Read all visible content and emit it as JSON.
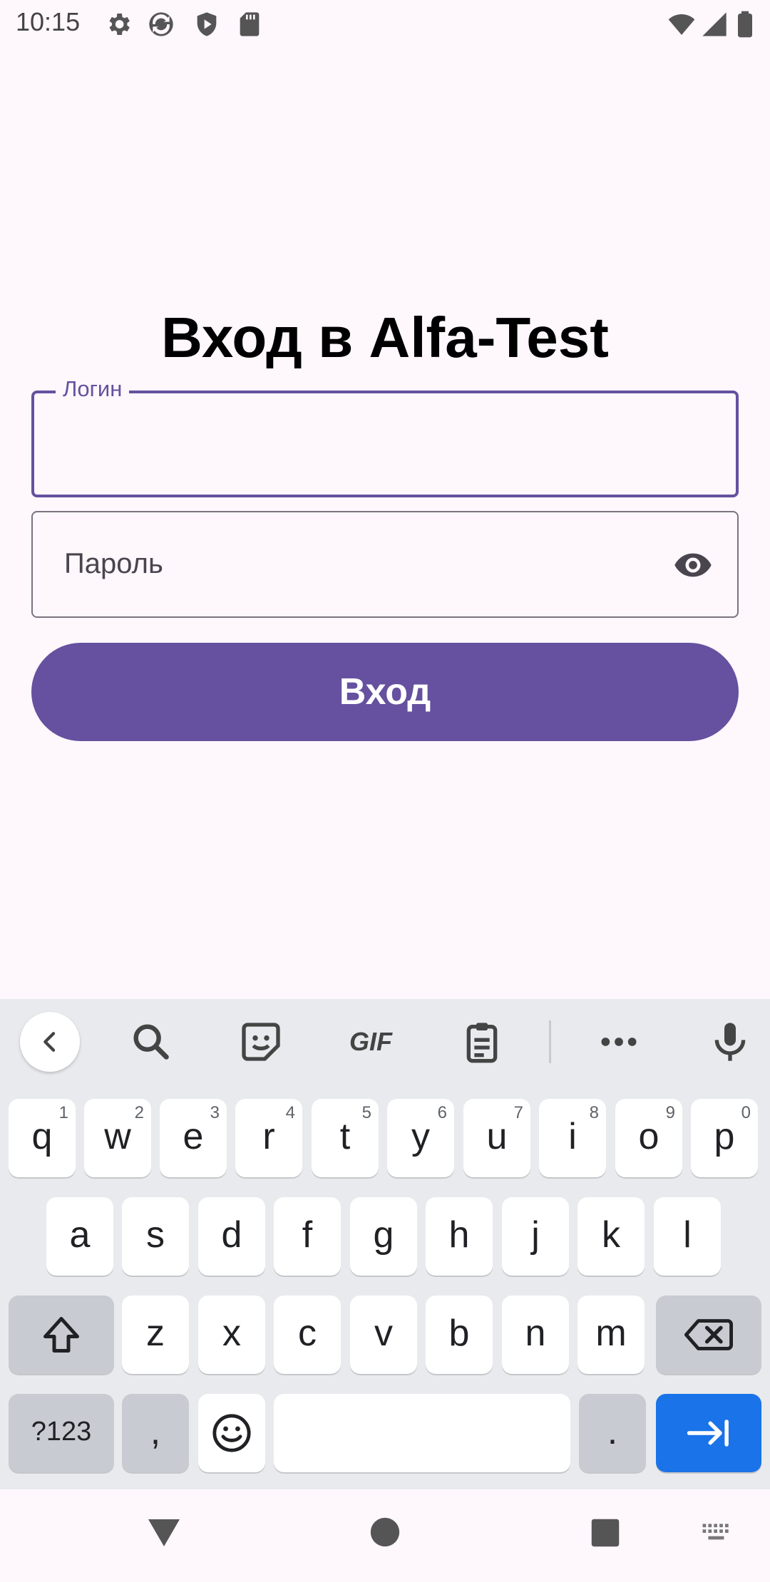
{
  "status_bar": {
    "time": "10:15",
    "icons": [
      "settings-icon",
      "sync-icon",
      "shield-play-icon",
      "sd-card-icon",
      "wifi-icon",
      "signal-icon",
      "battery-icon"
    ]
  },
  "login_screen": {
    "title": "Вход в Alfa-Test",
    "login_field": {
      "label": "Логин",
      "value": ""
    },
    "password_field": {
      "placeholder": "Пароль",
      "value": ""
    },
    "submit_label": "Вход",
    "accent_color": "#65519f"
  },
  "keyboard": {
    "toolbar_icons": [
      "back-icon",
      "search-icon",
      "sticker-icon",
      "gif-icon",
      "clipboard-icon",
      "more-icon",
      "mic-icon"
    ],
    "gif_label": "GIF",
    "row1": [
      {
        "k": "q",
        "h": "1"
      },
      {
        "k": "w",
        "h": "2"
      },
      {
        "k": "e",
        "h": "3"
      },
      {
        "k": "r",
        "h": "4"
      },
      {
        "k": "t",
        "h": "5"
      },
      {
        "k": "y",
        "h": "6"
      },
      {
        "k": "u",
        "h": "7"
      },
      {
        "k": "i",
        "h": "8"
      },
      {
        "k": "o",
        "h": "9"
      },
      {
        "k": "p",
        "h": "0"
      }
    ],
    "row2": [
      "a",
      "s",
      "d",
      "f",
      "g",
      "h",
      "j",
      "k",
      "l"
    ],
    "row3": [
      "z",
      "x",
      "c",
      "v",
      "b",
      "n",
      "m"
    ],
    "symbols_label": "?123",
    "comma": ",",
    "period": ".",
    "enter_color": "#1a73e8"
  },
  "nav_bar": {
    "icons": [
      "back-triangle-icon",
      "home-circle-icon",
      "recents-square-icon",
      "keyboard-switch-icon"
    ]
  }
}
